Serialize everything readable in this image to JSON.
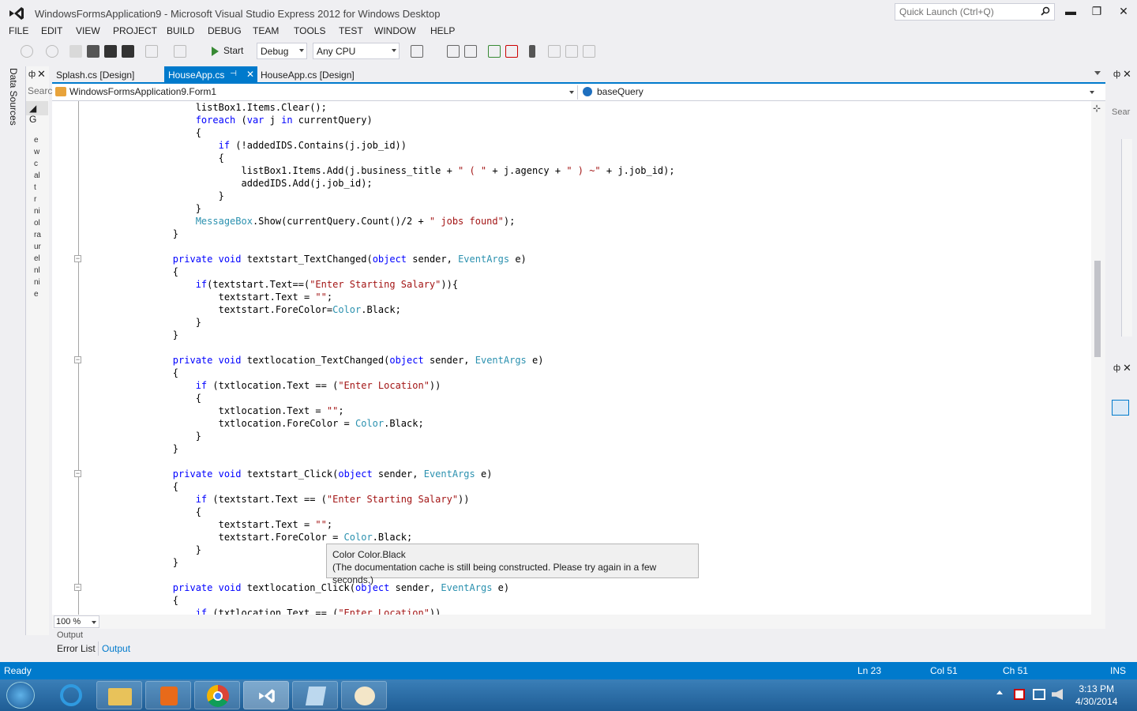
{
  "window": {
    "title": "WindowsFormsApplication9 - Microsoft Visual Studio Express 2012 for Windows Desktop",
    "quick_launch_placeholder": "Quick Launch (Ctrl+Q)",
    "minimize_glyph": "▬",
    "restore_glyph": "❐",
    "close_glyph": "✕"
  },
  "menu": [
    "FILE",
    "EDIT",
    "VIEW",
    "PROJECT",
    "BUILD",
    "DEBUG",
    "TEAM",
    "TOOLS",
    "TEST",
    "WINDOW",
    "HELP"
  ],
  "toolbar": {
    "start_label": "Start",
    "config_value": "Debug",
    "platform_value": "Any CPU"
  },
  "left_panel": {
    "title": "Data Sources",
    "search_placeholder": "Searc",
    "group_label": "G",
    "items": [
      "e",
      "w",
      "c",
      "al",
      "t",
      "r",
      "ni",
      "ol",
      "ra",
      "ur",
      "el",
      "nl",
      "ni",
      "e"
    ]
  },
  "tabs": [
    {
      "label": "Splash.cs [Design]"
    },
    {
      "label": "HouseApp.cs"
    },
    {
      "label": "HouseApp.cs [Design]"
    }
  ],
  "navbar": {
    "class_scope": "WindowsFormsApplication9.Form1",
    "member_scope": "baseQuery"
  },
  "tooltip": {
    "line1": "Color Color.Black",
    "line2": "(The documentation cache is still being constructed. Please try again in a few seconds.)"
  },
  "editor": {
    "zoom": "100 %"
  },
  "right_panel": {
    "search_placeholder": "Sear"
  },
  "bottom": {
    "output_header": "Output",
    "tabs": [
      "Error List",
      "Output"
    ]
  },
  "status": {
    "ready": "Ready",
    "line": "Ln 23",
    "col": "Col 51",
    "ch": "Ch 51",
    "mode": "INS"
  },
  "clock": {
    "time": "3:13 PM",
    "date": "4/30/2014"
  },
  "colors": {
    "accent": "#007acc",
    "keyword": "#0000ff",
    "type": "#2b91af",
    "string": "#a31515"
  }
}
